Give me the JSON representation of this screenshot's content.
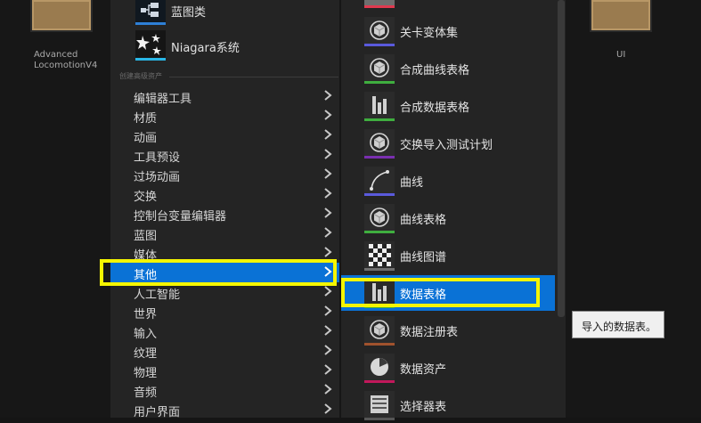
{
  "content_browser": {
    "assets_left": [
      {
        "name_line1": "Advanced",
        "name_line2": "LocomotionV4"
      }
    ],
    "assets_right": [
      {
        "name": "UI"
      }
    ]
  },
  "menu_primary": {
    "top_items": [
      {
        "label": "蓝图类",
        "icon": "blueprint-class-icon"
      },
      {
        "label": "Niagara系统",
        "icon": "niagara-system-icon"
      }
    ],
    "section_header": "创建高级资产",
    "categories": [
      {
        "label": "编辑器工具"
      },
      {
        "label": "材质"
      },
      {
        "label": "动画"
      },
      {
        "label": "工具预设"
      },
      {
        "label": "过场动画"
      },
      {
        "label": "交换"
      },
      {
        "label": "控制台变量编辑器"
      },
      {
        "label": "蓝图"
      },
      {
        "label": "媒体"
      },
      {
        "label": "其他",
        "selected": true
      },
      {
        "label": "人工智能"
      },
      {
        "label": "世界"
      },
      {
        "label": "输入"
      },
      {
        "label": "纹理"
      },
      {
        "label": "物理"
      },
      {
        "label": "音频"
      },
      {
        "label": "用户界面"
      }
    ]
  },
  "menu_submenu": {
    "items": [
      {
        "label": "关卡变体集",
        "icon": "sphere-asset-icon",
        "accent": "#5a5adc"
      },
      {
        "label": "合成曲线表格",
        "icon": "sphere-asset-icon",
        "accent": "#3fae3f"
      },
      {
        "label": "合成数据表格",
        "icon": "bar-chart-icon",
        "accent": "#3fae3f"
      },
      {
        "label": "交换导入测试计划",
        "icon": "sphere-asset-icon",
        "accent": "#7a2fb0"
      },
      {
        "label": "曲线",
        "icon": "curve-icon",
        "accent": "#5a5adc"
      },
      {
        "label": "曲线表格",
        "icon": "sphere-asset-icon",
        "accent": "#3fae3f"
      },
      {
        "label": "曲线图谱",
        "icon": "checker-icon",
        "accent": "#6e6e6e"
      },
      {
        "label": "数据表格",
        "icon": "bar-chart-icon",
        "accent": "#3fae3f",
        "selected": true
      },
      {
        "label": "数据注册表",
        "icon": "sphere-asset-icon",
        "accent": "#a0522d"
      },
      {
        "label": "数据资产",
        "icon": "pie-icon",
        "accent": "#c2185b"
      },
      {
        "label": "选择器表",
        "icon": "selector-table-icon",
        "accent": "#555555"
      }
    ]
  },
  "tooltip": {
    "text": "导入的数据表。"
  },
  "colors": {
    "selection": "#0a72d6",
    "highlight_box": "#f5f500"
  }
}
